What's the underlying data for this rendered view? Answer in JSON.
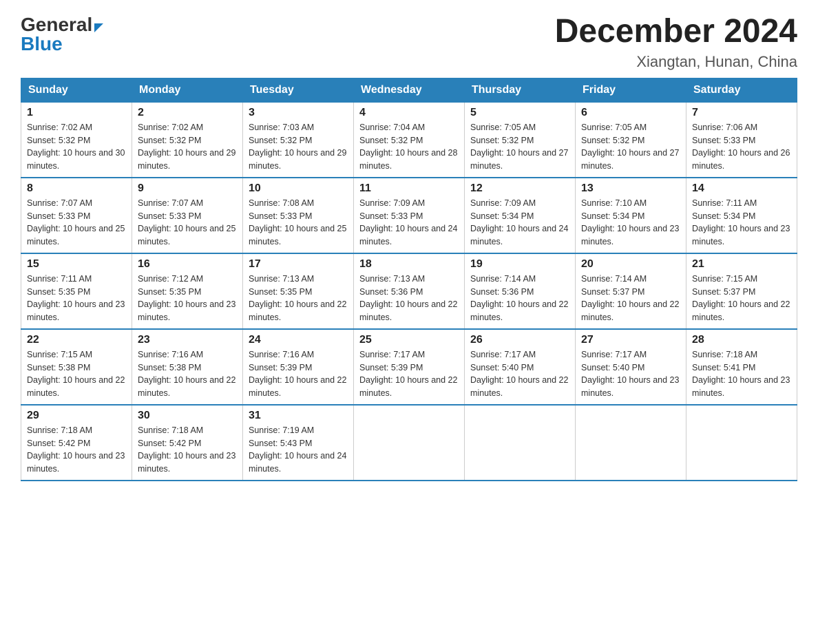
{
  "logo": {
    "general": "General",
    "blue": "Blue",
    "arrow": "▶"
  },
  "title": "December 2024",
  "subtitle": "Xiangtan, Hunan, China",
  "days_of_week": [
    "Sunday",
    "Monday",
    "Tuesday",
    "Wednesday",
    "Thursday",
    "Friday",
    "Saturday"
  ],
  "weeks": [
    [
      {
        "day": "1",
        "sunrise": "7:02 AM",
        "sunset": "5:32 PM",
        "daylight": "10 hours and 30 minutes."
      },
      {
        "day": "2",
        "sunrise": "7:02 AM",
        "sunset": "5:32 PM",
        "daylight": "10 hours and 29 minutes."
      },
      {
        "day": "3",
        "sunrise": "7:03 AM",
        "sunset": "5:32 PM",
        "daylight": "10 hours and 29 minutes."
      },
      {
        "day": "4",
        "sunrise": "7:04 AM",
        "sunset": "5:32 PM",
        "daylight": "10 hours and 28 minutes."
      },
      {
        "day": "5",
        "sunrise": "7:05 AM",
        "sunset": "5:32 PM",
        "daylight": "10 hours and 27 minutes."
      },
      {
        "day": "6",
        "sunrise": "7:05 AM",
        "sunset": "5:32 PM",
        "daylight": "10 hours and 27 minutes."
      },
      {
        "day": "7",
        "sunrise": "7:06 AM",
        "sunset": "5:33 PM",
        "daylight": "10 hours and 26 minutes."
      }
    ],
    [
      {
        "day": "8",
        "sunrise": "7:07 AM",
        "sunset": "5:33 PM",
        "daylight": "10 hours and 25 minutes."
      },
      {
        "day": "9",
        "sunrise": "7:07 AM",
        "sunset": "5:33 PM",
        "daylight": "10 hours and 25 minutes."
      },
      {
        "day": "10",
        "sunrise": "7:08 AM",
        "sunset": "5:33 PM",
        "daylight": "10 hours and 25 minutes."
      },
      {
        "day": "11",
        "sunrise": "7:09 AM",
        "sunset": "5:33 PM",
        "daylight": "10 hours and 24 minutes."
      },
      {
        "day": "12",
        "sunrise": "7:09 AM",
        "sunset": "5:34 PM",
        "daylight": "10 hours and 24 minutes."
      },
      {
        "day": "13",
        "sunrise": "7:10 AM",
        "sunset": "5:34 PM",
        "daylight": "10 hours and 23 minutes."
      },
      {
        "day": "14",
        "sunrise": "7:11 AM",
        "sunset": "5:34 PM",
        "daylight": "10 hours and 23 minutes."
      }
    ],
    [
      {
        "day": "15",
        "sunrise": "7:11 AM",
        "sunset": "5:35 PM",
        "daylight": "10 hours and 23 minutes."
      },
      {
        "day": "16",
        "sunrise": "7:12 AM",
        "sunset": "5:35 PM",
        "daylight": "10 hours and 23 minutes."
      },
      {
        "day": "17",
        "sunrise": "7:13 AM",
        "sunset": "5:35 PM",
        "daylight": "10 hours and 22 minutes."
      },
      {
        "day": "18",
        "sunrise": "7:13 AM",
        "sunset": "5:36 PM",
        "daylight": "10 hours and 22 minutes."
      },
      {
        "day": "19",
        "sunrise": "7:14 AM",
        "sunset": "5:36 PM",
        "daylight": "10 hours and 22 minutes."
      },
      {
        "day": "20",
        "sunrise": "7:14 AM",
        "sunset": "5:37 PM",
        "daylight": "10 hours and 22 minutes."
      },
      {
        "day": "21",
        "sunrise": "7:15 AM",
        "sunset": "5:37 PM",
        "daylight": "10 hours and 22 minutes."
      }
    ],
    [
      {
        "day": "22",
        "sunrise": "7:15 AM",
        "sunset": "5:38 PM",
        "daylight": "10 hours and 22 minutes."
      },
      {
        "day": "23",
        "sunrise": "7:16 AM",
        "sunset": "5:38 PM",
        "daylight": "10 hours and 22 minutes."
      },
      {
        "day": "24",
        "sunrise": "7:16 AM",
        "sunset": "5:39 PM",
        "daylight": "10 hours and 22 minutes."
      },
      {
        "day": "25",
        "sunrise": "7:17 AM",
        "sunset": "5:39 PM",
        "daylight": "10 hours and 22 minutes."
      },
      {
        "day": "26",
        "sunrise": "7:17 AM",
        "sunset": "5:40 PM",
        "daylight": "10 hours and 22 minutes."
      },
      {
        "day": "27",
        "sunrise": "7:17 AM",
        "sunset": "5:40 PM",
        "daylight": "10 hours and 23 minutes."
      },
      {
        "day": "28",
        "sunrise": "7:18 AM",
        "sunset": "5:41 PM",
        "daylight": "10 hours and 23 minutes."
      }
    ],
    [
      {
        "day": "29",
        "sunrise": "7:18 AM",
        "sunset": "5:42 PM",
        "daylight": "10 hours and 23 minutes."
      },
      {
        "day": "30",
        "sunrise": "7:18 AM",
        "sunset": "5:42 PM",
        "daylight": "10 hours and 23 minutes."
      },
      {
        "day": "31",
        "sunrise": "7:19 AM",
        "sunset": "5:43 PM",
        "daylight": "10 hours and 24 minutes."
      },
      null,
      null,
      null,
      null
    ]
  ]
}
